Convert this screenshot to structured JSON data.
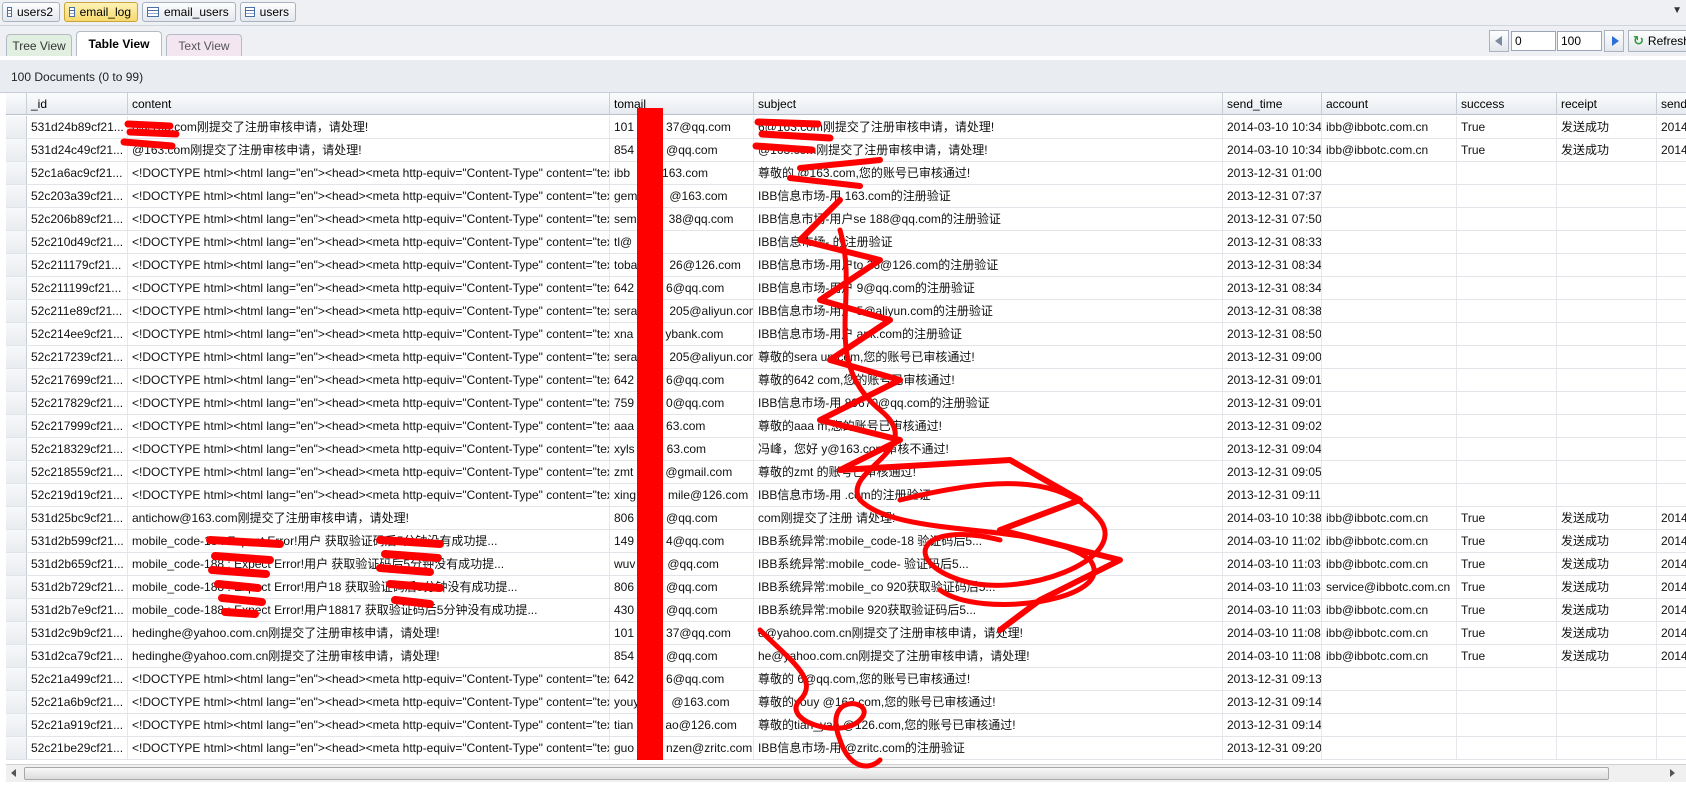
{
  "collections": [
    "users2",
    "email_log",
    "email_users",
    "users"
  ],
  "active_collection": 1,
  "view_tabs": [
    "Tree View",
    "Table View",
    "Text View"
  ],
  "paging": {
    "skip": "0",
    "limit": "100",
    "refresh_label": "Refresh"
  },
  "doc_count": "100 Documents (0 to 99)",
  "columns": [
    "_id",
    "content",
    "tomail",
    "subject",
    "send_time",
    "account",
    "success",
    "receipt",
    "send_"
  ],
  "rows": [
    [
      "531d24b89cf21...",
      "6@163.com刚提交了注册审核申请，请处理!",
      "101",
      "37@qq.com",
      "6@163.com刚提交了注册审核申请，请处理!",
      "2014-03-10 10:34",
      "ibb@ibbotc.com.cn",
      "True",
      "发送成功",
      "2014"
    ],
    [
      "531d24c49cf21...",
      "@163.com刚提交了注册审核申请，请处理!",
      "854",
      "@qq.com",
      "@163.com刚提交了注册审核申请，请处理!",
      "2014-03-10 10:34",
      "ibb@ibbotc.com.cn",
      "True",
      "发送成功",
      "2014"
    ],
    [
      "52c1a6ac9cf21...",
      "<!DOCTYPE html><html lang=\"en\"><head><meta http-equiv=\"Content-Type\" content=\"text/html...",
      "ibb",
      "163.com",
      "尊敬的            @163.com,您的账号已审核通过!",
      "2013-12-31 01:00",
      "",
      "",
      "",
      ""
    ],
    [
      "52c203a39cf21...",
      "<!DOCTYPE html><html lang=\"en\"><head><meta http-equiv=\"Content-Type\" content=\"text/html...",
      "gem",
      "@163.com",
      "IBB信息市场-用              163.com的注册验证",
      "2013-12-31 07:37",
      "",
      "",
      "",
      ""
    ],
    [
      "52c206b89cf21...",
      "<!DOCTYPE html><html lang=\"en\"><head><meta http-equiv=\"Content-Type\" content=\"text/html...",
      "sem",
      "38@qq.com",
      "IBB信息市场-用户se          188@qq.com的注册验证",
      "2013-12-31 07:50",
      "",
      "",
      "",
      ""
    ],
    [
      "52c210d49cf21...",
      "<!DOCTYPE html><html lang=\"en\"><head><meta http-equiv=\"Content-Type\" content=\"text/html...",
      "tl@",
      "",
      "IBB信息市场-             的注册验证",
      "2013-12-31 08:33",
      "",
      "",
      "",
      ""
    ],
    [
      "52c211179cf21...",
      "<!DOCTYPE html><html lang=\"en\"><head><meta http-equiv=\"Content-Type\" content=\"text/html...",
      "toba",
      "26@126.com",
      "IBB信息市场-用户to         26@126.com的注册验证",
      "2013-12-31 08:34",
      "",
      "",
      "",
      ""
    ],
    [
      "52c211199cf21...",
      "<!DOCTYPE html><html lang=\"en\"><head><meta http-equiv=\"Content-Type\" content=\"text/html...",
      "642",
      "6@qq.com",
      "IBB信息市场-用户        9@qq.com的注册验证",
      "2013-12-31 08:34",
      "",
      "",
      "",
      ""
    ],
    [
      "52c211e89cf21...",
      "<!DOCTYPE html><html lang=\"en\"><head><meta http-equiv=\"Content-Type\" content=\"text/html...",
      "sera",
      "205@aliyun.com",
      "IBB信息市场-用户         5@aliyun.com的注册验证",
      "2013-12-31 08:38",
      "",
      "",
      "",
      ""
    ],
    [
      "52c214ee9cf21...",
      "<!DOCTYPE html><html lang=\"en\"><head><meta http-equiv=\"Content-Type\" content=\"text/html...",
      "xna",
      "ybank.com",
      "IBB信息市场-用户        ank.com的注册验证",
      "2013-12-31 08:50",
      "",
      "",
      "",
      ""
    ],
    [
      "52c217239cf21...",
      "<!DOCTYPE html><html lang=\"en\"><head><meta http-equiv=\"Content-Type\" content=\"text/html...",
      "sera",
      "205@aliyun.com",
      "尊敬的sera           un.com,您的账号已审核通过!",
      "2013-12-31 09:00",
      "",
      "",
      "",
      ""
    ],
    [
      "52c217699cf21...",
      "<!DOCTYPE html><html lang=\"en\"><head><meta http-equiv=\"Content-Type\" content=\"text/html...",
      "642",
      "6@qq.com",
      "尊敬的642            com,您的账号已审核通过!",
      "2013-12-31 09:01",
      "",
      "",
      "",
      ""
    ],
    [
      "52c217829cf21...",
      "<!DOCTYPE html><html lang=\"en\"><head><meta http-equiv=\"Content-Type\" content=\"text/html...",
      "759",
      "0@qq.com",
      "IBB信息市场-用          89670@qq.com的注册验证",
      "2013-12-31 09:01",
      "",
      "",
      "",
      ""
    ],
    [
      "52c217999cf21...",
      "<!DOCTYPE html><html lang=\"en\"><head><meta http-equiv=\"Content-Type\" content=\"text/html...",
      "aaa",
      "63.com",
      "尊敬的aaa          m,您的账号已审核通过!",
      "2013-12-31 09:02",
      "",
      "",
      "",
      ""
    ],
    [
      "52c218329cf21...",
      "<!DOCTYPE html><html lang=\"en\"><head><meta http-equiv=\"Content-Type\" content=\"text/html...",
      "xyls",
      "63.com",
      "冯峰，您好               y@163.com审核不通过!",
      "2013-12-31 09:04",
      "",
      "",
      "",
      ""
    ],
    [
      "52c218559cf21...",
      "<!DOCTYPE html><html lang=\"en\"><head><meta http-equiv=\"Content-Type\" content=\"text/html...",
      "zmt",
      "@gmail.com",
      "尊敬的zmt                  的账号已审核通过!",
      "2013-12-31 09:05",
      "",
      "",
      "",
      ""
    ],
    [
      "52c219d19cf21...",
      "<!DOCTYPE html><html lang=\"en\"><head><meta http-equiv=\"Content-Type\" content=\"text/html...",
      "xing",
      "mile@126.com",
      "IBB信息市场-用                  .com的注册验证",
      "2013-12-31 09:11",
      "",
      "",
      "",
      ""
    ],
    [
      "531d25bc9cf21...",
      "antichow@163.com刚提交了注册审核申请，请处理!",
      "806",
      "@qq.com",
      "com刚提交了注册        请处理!",
      "2014-03-10 10:38",
      "ibb@ibbotc.com.cn",
      "True",
      "发送成功",
      "2014"
    ],
    [
      "531d2b599cf21...",
      "mobile_code-18             : Expect Error!用户          获取验证码后5分钟没有成功提...",
      "149",
      "4@qq.com",
      "IBB系统异常:mobile_code-18                            验证码后5...",
      "2014-03-10 11:02",
      "ibb@ibbotc.com.cn",
      "True",
      "发送成功",
      "2014"
    ],
    [
      "531d2b659cf21...",
      "mobile_code-188             : Expect Error!用户          获取验证码后5分钟没有成功提...",
      "wuv",
      "@qq.com",
      "IBB系统异常:mobile_code-                              验证码后5...",
      "2014-03-10 11:03",
      "ibb@ibbotc.com.cn",
      "True",
      "发送成功",
      "2014"
    ],
    [
      "531d2b729cf21...",
      "mobile_code-188             : Expect Error!用户18          获取验证码后5分钟没有成功提...",
      "806",
      "@qq.com",
      "IBB系统异常:mobile_co                920获取验证码后5...",
      "2014-03-10 11:03",
      "service@ibbotc.com.cn",
      "True",
      "发送成功",
      "2014"
    ],
    [
      "531d2b7e9cf21...",
      "mobile_code-188             : Expect Error!用户18817          获取验证码后5分钟没有成功提...",
      "430",
      "@qq.com",
      "IBB系统异常:mobile                920获取验证码后5...",
      "2014-03-10 11:03",
      "ibb@ibbotc.com.cn",
      "True",
      "发送成功",
      "2014"
    ],
    [
      "531d2c9b9cf21...",
      "hedinghe@yahoo.com.cn刚提交了注册审核申请，请处理!",
      "101",
      "37@qq.com",
      "e@yahoo.com.cn刚提交了注册审核申请，请处理!",
      "2014-03-10 11:08",
      "ibb@ibbotc.com.cn",
      "True",
      "发送成功",
      "2014"
    ],
    [
      "531d2ca79cf21...",
      "hedinghe@yahoo.com.cn刚提交了注册审核申请，请处理!",
      "854",
      "@qq.com",
      "he@yahoo.com.cn刚提交了注册审核申请，请处理!",
      "2014-03-10 11:08",
      "ibb@ibbotc.com.cn",
      "True",
      "发送成功",
      "2014"
    ],
    [
      "52c21a499cf21...",
      "<!DOCTYPE html><html lang=\"en\"><head><meta http-equiv=\"Content-Type\" content=\"text/html...",
      "642",
      "6@qq.com",
      "尊敬的           6@qq.com,您的账号已审核通过!",
      "2013-12-31 09:13",
      "",
      "",
      "",
      ""
    ],
    [
      "52c21a6b9cf21...",
      "<!DOCTYPE html><html lang=\"en\"><head><meta http-equiv=\"Content-Type\" content=\"text/html...",
      "youy",
      "@163.com",
      "尊敬的youy          @163.com,您的账号已审核通过!",
      "2013-12-31 09:14",
      "",
      "",
      "",
      ""
    ],
    [
      "52c21a919cf21...",
      "<!DOCTYPE html><html lang=\"en\"><head><meta http-equiv=\"Content-Type\" content=\"text/html...",
      "tian",
      "ao@126.com",
      "尊敬的tian_yao         @126.com,您的账号已审核通过!",
      "2013-12-31 09:14",
      "",
      "",
      "",
      ""
    ],
    [
      "52c21be29cf21...",
      "<!DOCTYPE html><html lang=\"en\"><head><meta http-equiv=\"Content-Type\" content=\"text/html...",
      "guo",
      "nzen@zritc.com",
      "IBB信息市场-用            @zritc.com的注册验证",
      "2013-12-31 09:20",
      "",
      "",
      "",
      ""
    ]
  ],
  "icons": {
    "collection": "table-icon",
    "refresh": "refresh-icon",
    "prev": "prev-arrow-icon",
    "next": "next-arrow-icon",
    "dropdown": "dropdown-arrow-icon"
  },
  "colors": {
    "active_tab": "#f7d96b",
    "accent_border": "#f0c58b",
    "redaction": "#ff0000"
  }
}
